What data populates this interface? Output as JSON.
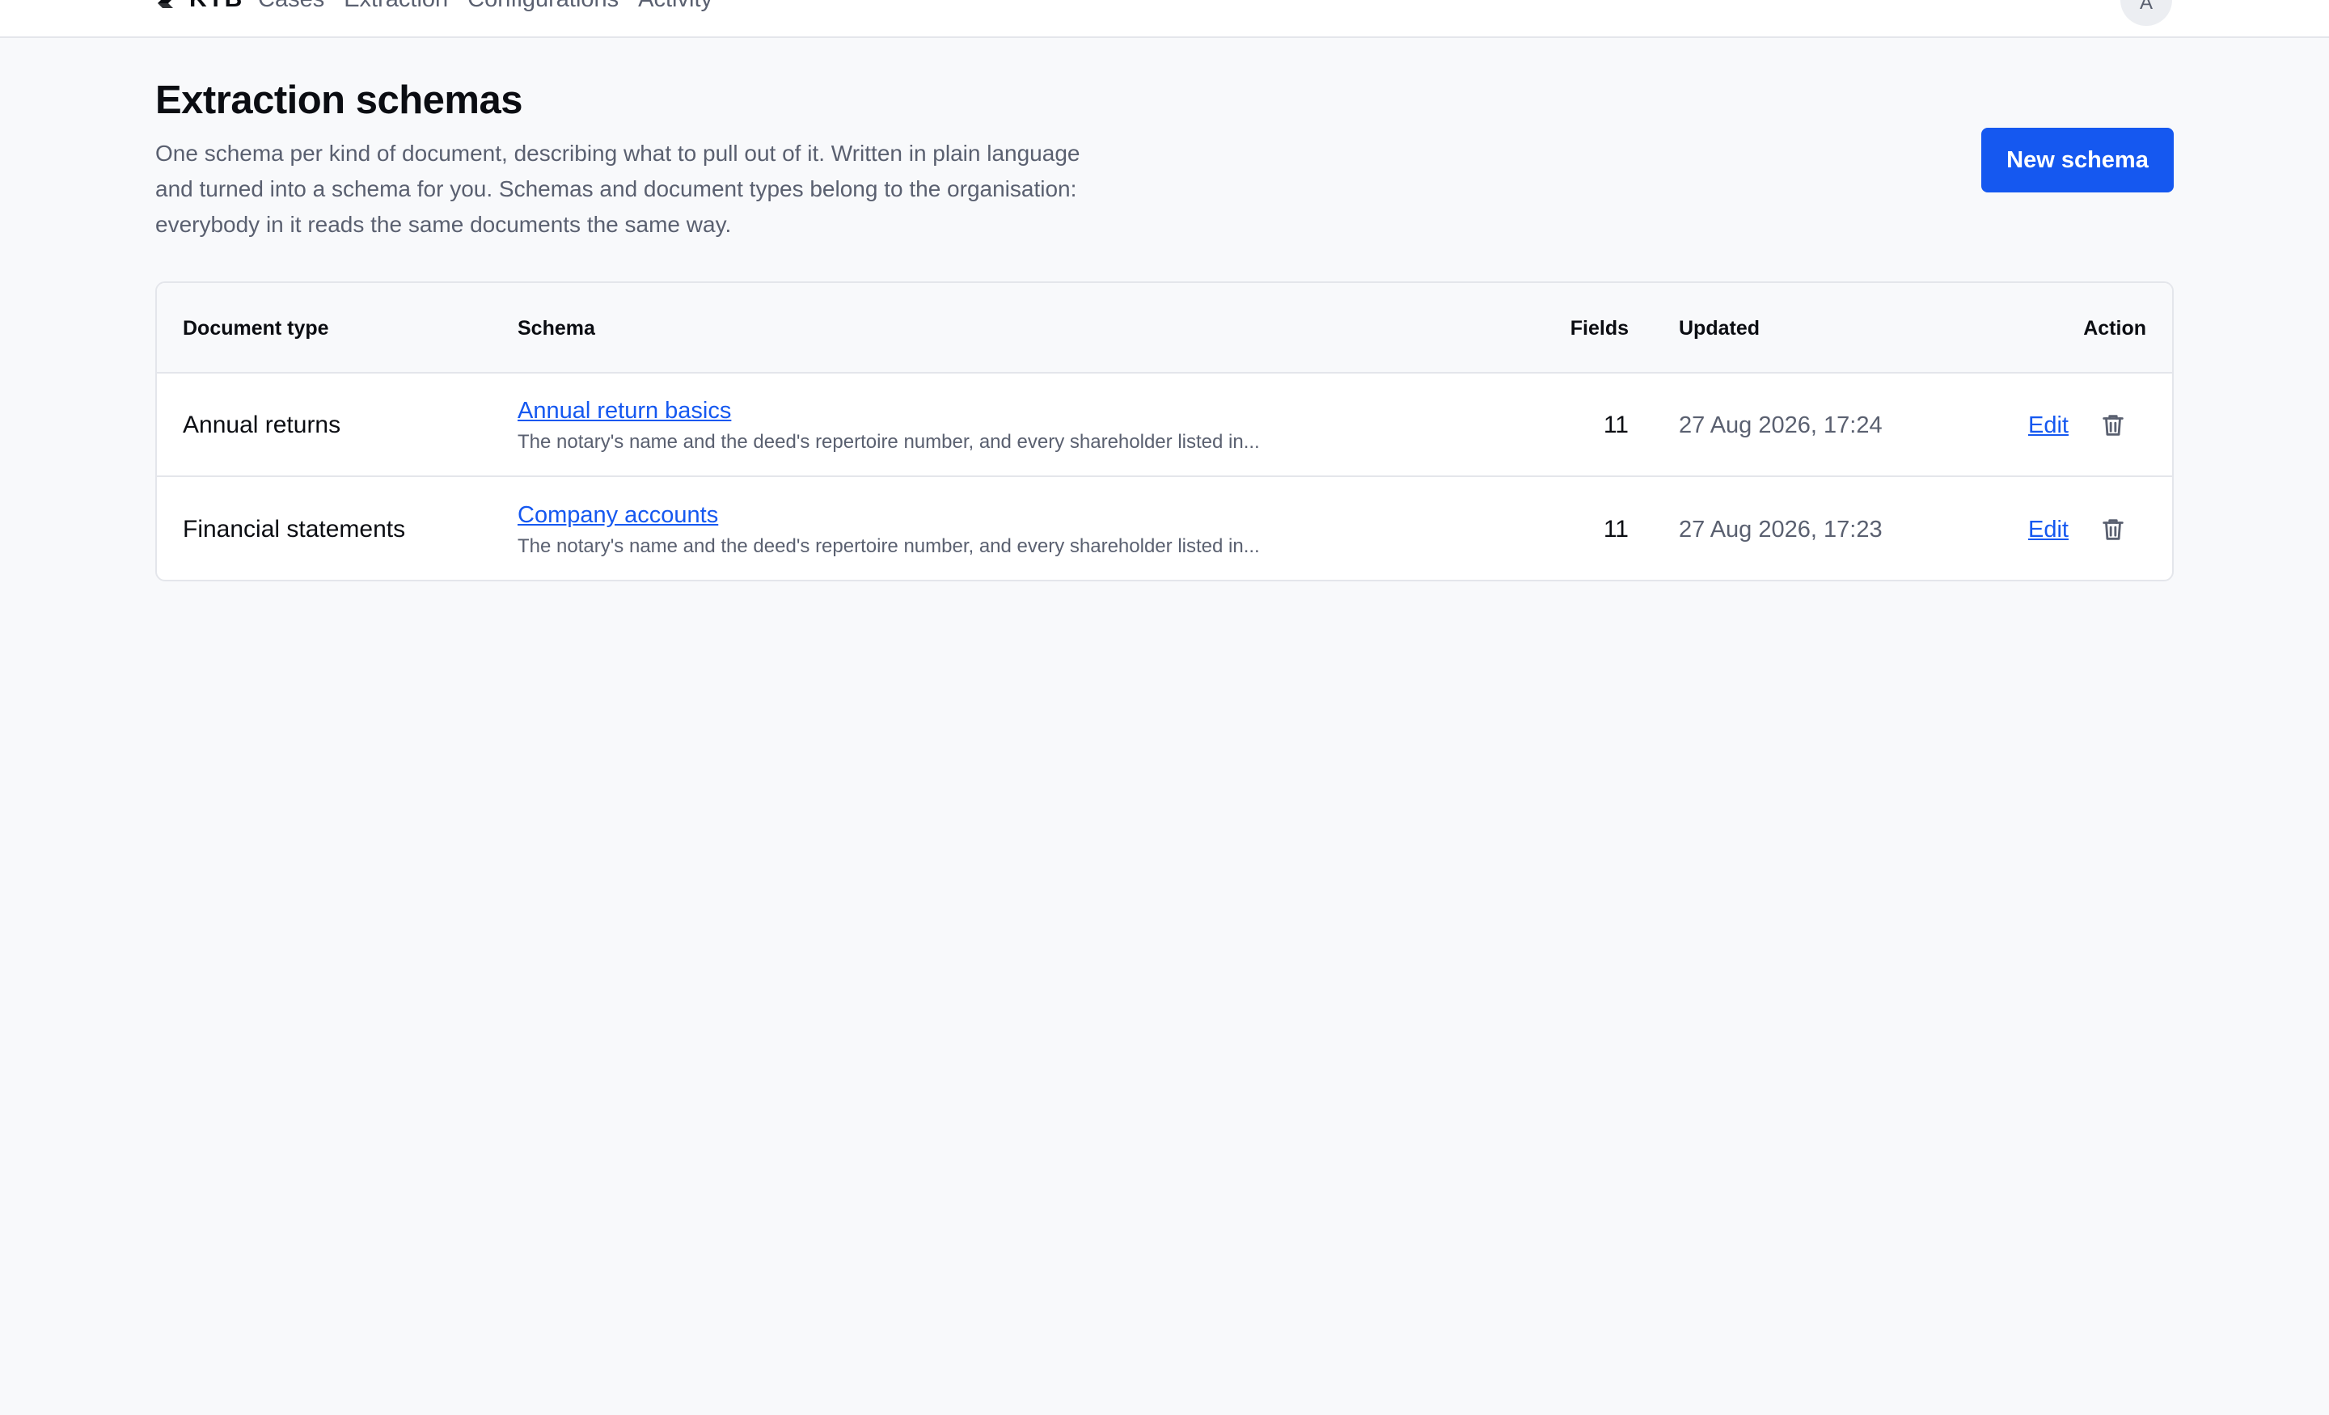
{
  "app": {
    "brand": "KYB",
    "nav": [
      "Cases",
      "Extraction",
      "Configurations",
      "Activity"
    ],
    "avatar_initial": "A"
  },
  "header": {
    "title": "Extraction schemas",
    "description": "One schema per kind of document, describing what to pull out of it. Written in plain language and turned into a schema for you. Schemas and document types belong to the organisation: everybody in it reads the same documents the same way.",
    "new_button": "New schema"
  },
  "table": {
    "columns": {
      "document_type": "Document type",
      "schema": "Schema",
      "fields": "Fields",
      "updated": "Updated",
      "action": "Action"
    },
    "rows": [
      {
        "document_type": "Annual returns",
        "schema_name": "Annual return basics",
        "schema_desc": "The notary's name and the deed's repertoire number, and every shareholder listed in...",
        "fields": "11",
        "updated": "27 Aug 2026, 17:24",
        "edit": "Edit"
      },
      {
        "document_type": "Financial statements",
        "schema_name": "Company accounts",
        "schema_desc": "The notary's name and the deed's repertoire number, and every shareholder listed in...",
        "fields": "11",
        "updated": "27 Aug 2026, 17:23",
        "edit": "Edit"
      }
    ]
  },
  "icons": {
    "brand": "brand-mark-icon",
    "delete": "trash-icon"
  },
  "colors": {
    "accent": "#1558f0",
    "background": "#f8f9fb",
    "border": "#e4e6eb",
    "muted_text": "#5a6070"
  }
}
